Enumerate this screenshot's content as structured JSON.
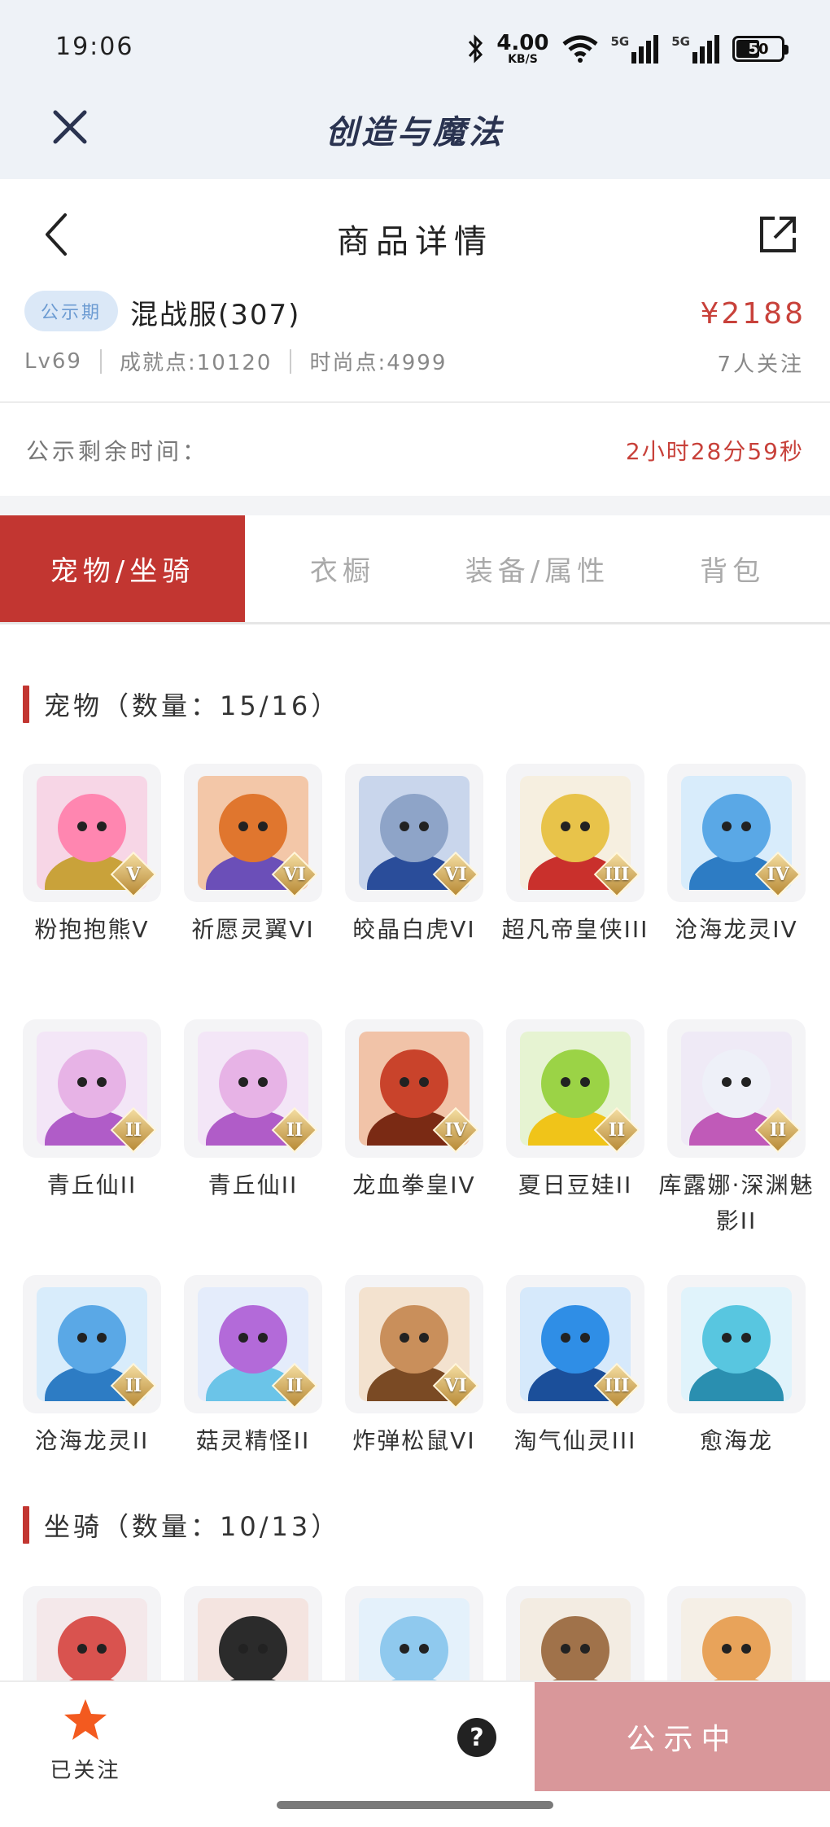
{
  "status_bar": {
    "time": "19:06",
    "net_speed": "4.00",
    "net_speed_unit": "KB/S",
    "network_1": "5G",
    "network_2": "5G",
    "battery": "50"
  },
  "app_bar": {
    "title": "创造与魔法",
    "close_icon": "close-icon"
  },
  "page_header": {
    "title": "商品详情",
    "back_icon": "back-arrow-icon",
    "share_icon": "share-icon"
  },
  "product": {
    "badge": "公示期",
    "name": "混战服(307)",
    "price": "¥2188",
    "level": "Lv69",
    "achievement": "成就点:10120",
    "fashion": "时尚点:4999",
    "followers": "7人关注"
  },
  "countdown": {
    "label": "公示剩余时间：",
    "value": "2小时28分59秒"
  },
  "tabs": [
    {
      "label": "宠物/坐骑",
      "active": true
    },
    {
      "label": "衣橱",
      "active": false
    },
    {
      "label": "装备/属性",
      "active": false
    },
    {
      "label": "背包",
      "active": false
    }
  ],
  "pets_section": {
    "title": "宠物（数量：15/16）",
    "items": [
      {
        "name": "粉抱抱熊V",
        "tier": "V",
        "bg": "#f7d6e6",
        "skin": "#ff86b0",
        "accent": "#c9a23a"
      },
      {
        "name": "祈愿灵翼VI",
        "tier": "VI",
        "bg": "#f3c7a8",
        "skin": "#e0762e",
        "accent": "#6b4fb8"
      },
      {
        "name": "皎晶白虎VI",
        "tier": "VI",
        "bg": "#c9d6ec",
        "skin": "#8ea4c8",
        "accent": "#2a4d9a"
      },
      {
        "name": "超凡帝皇侠III",
        "tier": "III",
        "bg": "#f6efe0",
        "skin": "#e8c34a",
        "accent": "#c9302c"
      },
      {
        "name": "沧海龙灵IV",
        "tier": "IV",
        "bg": "#d8ecfb",
        "skin": "#5aa8e6",
        "accent": "#2d7cc4"
      },
      {
        "name": "青丘仙II",
        "tier": "II",
        "bg": "#f3e6f7",
        "skin": "#e7b3e6",
        "accent": "#b05cc8"
      },
      {
        "name": "青丘仙II",
        "tier": "II",
        "bg": "#f3e6f7",
        "skin": "#e7b3e6",
        "accent": "#b05cc8"
      },
      {
        "name": "龙血拳皇IV",
        "tier": "IV",
        "bg": "#f1c3a8",
        "skin": "#c9432b",
        "accent": "#7a2a14"
      },
      {
        "name": "夏日豆娃II",
        "tier": "II",
        "bg": "#e6f3d2",
        "skin": "#9bd346",
        "accent": "#f0c419"
      },
      {
        "name": "库露娜·深渊魅影II",
        "tier": "II",
        "bg": "#efeaf6",
        "skin": "#eef0f8",
        "accent": "#c05ab8"
      },
      {
        "name": "沧海龙灵II",
        "tier": "II",
        "bg": "#d8ecfb",
        "skin": "#5aa8e6",
        "accent": "#2d7cc4"
      },
      {
        "name": "菇灵精怪II",
        "tier": "II",
        "bg": "#e4ecfb",
        "skin": "#b36ad9",
        "accent": "#6bc4e8"
      },
      {
        "name": "炸弹松鼠VI",
        "tier": "VI",
        "bg": "#f3e2cf",
        "skin": "#c98f5b",
        "accent": "#7a4a24"
      },
      {
        "name": "淘气仙灵III",
        "tier": "III",
        "bg": "#d6e9fb",
        "skin": "#2f8ee6",
        "accent": "#1b4f9a"
      },
      {
        "name": "愈海龙",
        "tier": "",
        "bg": "#e0f3fb",
        "skin": "#58c6e0",
        "accent": "#2a8fb0"
      }
    ]
  },
  "mounts_section": {
    "title": "坐骑（数量：10/13）",
    "items": [
      {
        "bg": "#f4e8ea",
        "skin": "#d9534f"
      },
      {
        "bg": "#f4e4e0",
        "skin": "#2b2b2b"
      },
      {
        "bg": "#e4f1fb",
        "skin": "#8fc9ee"
      },
      {
        "bg": "#f3ece2",
        "skin": "#a0724a"
      },
      {
        "bg": "#f5efe6",
        "skin": "#e8a35a"
      }
    ]
  },
  "bottom_bar": {
    "follow_label": "已关注",
    "help_label": "?",
    "action_label": "公示中",
    "colors": {
      "accent": "#c23631",
      "star": "#f35a1f",
      "action_bg": "#d9979a"
    }
  }
}
